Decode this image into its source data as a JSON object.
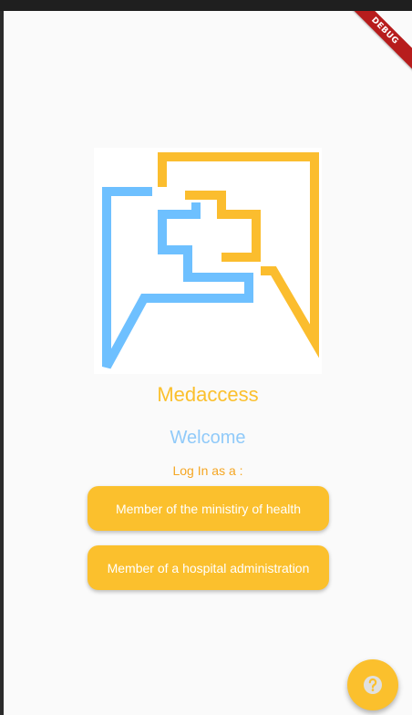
{
  "debug_banner": "DEBUG",
  "app": {
    "name": "Medaccess",
    "welcome": "Welcome",
    "login_prompt": "Log In as a :"
  },
  "buttons": {
    "ministry": "Member of the ministiry of health",
    "hospital": "Member of a hospital administration"
  },
  "fab": {
    "icon": "help-icon"
  },
  "colors": {
    "accent": "#fbc02d",
    "secondary": "#90caf9",
    "logo_blue": "#6ec0ff",
    "logo_yellow": "#fbbd2e"
  }
}
